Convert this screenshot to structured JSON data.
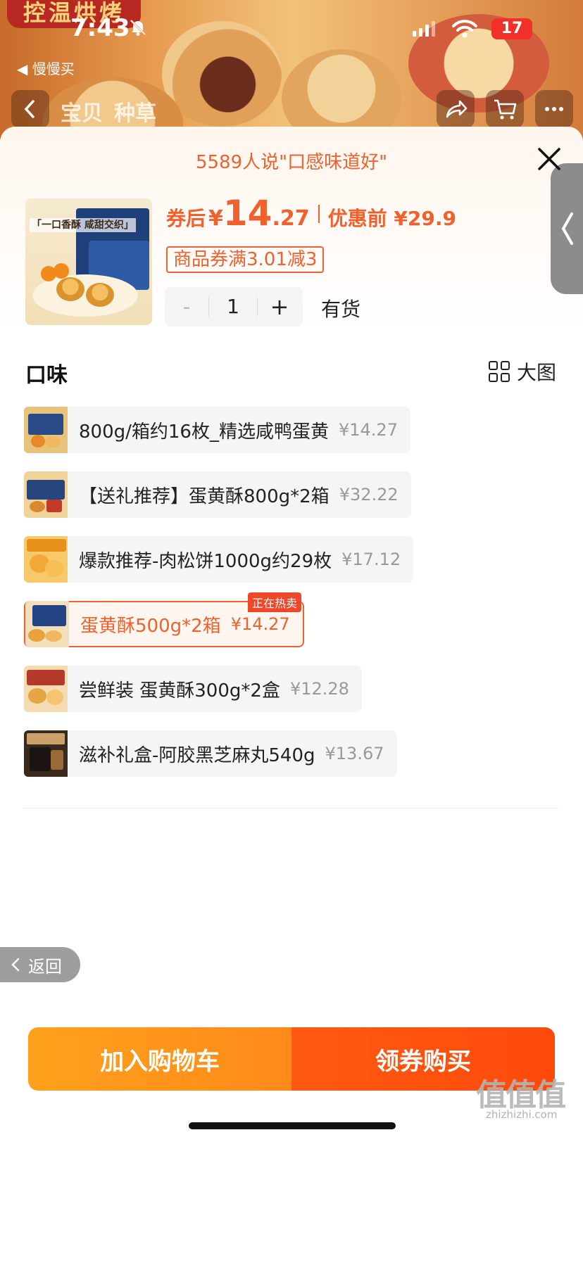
{
  "status_bar": {
    "time": "7:43",
    "battery": "17",
    "back_app": "◀ 慢慢买"
  },
  "background": {
    "banner_text": "控温烘烤"
  },
  "top_nav": {
    "tab_item": "宝贝",
    "tab_review": "种草"
  },
  "sheet": {
    "reviews_line": "5589人说\"口感味道好\"",
    "price": {
      "after_label": "券后",
      "currency": "¥",
      "int": "14",
      "dec": ".27",
      "original": "优惠前 ¥29.9"
    },
    "thumb_text": "「一口香酥 咸甜交织」",
    "coupon": "商品券满3.01减3",
    "quantity": {
      "minus": "-",
      "value": "1",
      "plus": "+"
    },
    "stock": "有货",
    "section_title": "口味",
    "big_view": "大图",
    "options": [
      {
        "name": "800g/箱约16枚_精选咸鸭蛋黄",
        "price": "¥14.27",
        "selected": false
      },
      {
        "name": "【送礼推荐】蛋黄酥800g*2箱",
        "price": "¥32.22",
        "selected": false
      },
      {
        "name": "爆款推荐-肉松饼1000g约29枚",
        "price": "¥17.12",
        "selected": false
      },
      {
        "name": "蛋黄酥500g*2箱",
        "price": "¥14.27",
        "selected": true,
        "badge": "正在热卖"
      },
      {
        "name": "尝鲜装 蛋黄酥300g*2盒",
        "price": "¥12.28",
        "selected": false
      },
      {
        "name": "滋补礼盒-阿胶黑芝麻丸540g",
        "price": "¥13.67",
        "selected": false
      }
    ],
    "float_back": "返回",
    "add_to_cart": "加入购物车",
    "buy_now": "领券购买"
  },
  "watermark": {
    "logo": "值值值",
    "site": "zhizhizhi.com"
  },
  "colors": {
    "accent": "#f0612d",
    "cart": "#ff9a1c",
    "buy": "#ff4e0e"
  }
}
